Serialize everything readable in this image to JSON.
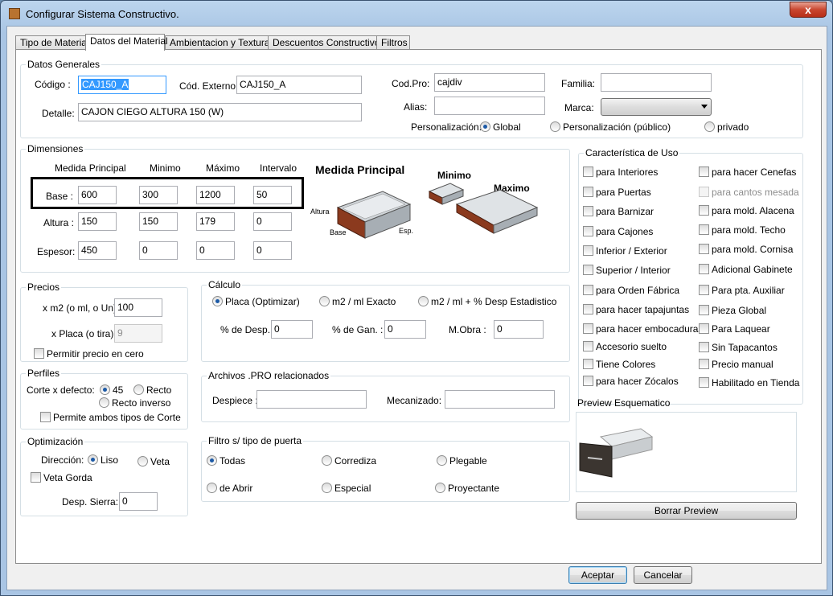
{
  "window": {
    "title": "Configurar Sistema Constructivo.",
    "close_glyph": "x"
  },
  "tabs": [
    "Tipo de Material",
    "Datos del Material",
    "Ambientacion y Texturas",
    "Descuentos Constructivos",
    "Filtros"
  ],
  "datos_generales": {
    "title": "Datos Generales",
    "codigo_label": "Código :",
    "codigo_value": "CAJ150_A",
    "cod_externo_label": "Cód. Externo :",
    "cod_externo_value": "CAJ150_A",
    "detalle_label": "Detalle:",
    "detalle_value": "CAJON CIEGO ALTURA 150 (W)",
    "cod_pro_label": "Cod.Pro:",
    "cod_pro_value": "cajdiv",
    "alias_label": "Alias:",
    "alias_value": "",
    "familia_label": "Familia:",
    "familia_value": "",
    "marca_label": "Marca:",
    "marca_value": "",
    "personalizacion_label": "Personalización:",
    "pers_global": "Global",
    "pers_publico": "Personalización (público)",
    "pers_privado": "privado"
  },
  "dimensiones": {
    "title": "Dimensiones",
    "headers": [
      "Medida Principal",
      "Minimo",
      "Máximo",
      "Intervalo"
    ],
    "rows": [
      {
        "label": "Base :",
        "values": [
          "600",
          "300",
          "1200",
          "50"
        ]
      },
      {
        "label": "Altura :",
        "values": [
          "150",
          "150",
          "179",
          "0"
        ]
      },
      {
        "label": "Espesor:",
        "values": [
          "450",
          "0",
          "0",
          "0"
        ]
      }
    ],
    "image_labels": {
      "medida": "Medida Principal",
      "minimo": "Minimo",
      "maximo": "Maximo",
      "altura": "Altura",
      "base": "Base",
      "esp": "Esp."
    }
  },
  "caracteristica": {
    "title": "Característica de Uso",
    "left": [
      "para Interiores",
      "para Puertas",
      "para Barnizar",
      "para Cajones",
      "Inferior / Exterior",
      "Superior / Interior",
      "para Orden Fábrica",
      "para hacer tapajuntas",
      "para hacer embocaduras",
      "Accesorio suelto",
      "Tiene Colores",
      "para hacer Zócalos"
    ],
    "right": [
      "para hacer Cenefas",
      "para cantos mesada",
      "para mold. Alacena",
      "para mold. Techo",
      "para mold. Cornisa",
      "Adicional Gabinete",
      "Para pta. Auxiliar",
      "Pieza Global",
      "Para Laquear",
      "Sin Tapacantos",
      "Precio manual",
      "Habilitado en Tienda"
    ]
  },
  "precios": {
    "title": "Precios",
    "xm2_label": "x m2 (o ml, o Un) :",
    "xm2_value": "100",
    "xplaca_label": "x Placa (o tira) :",
    "xplaca_value": "9",
    "permitir_cero": "Permitir precio en cero"
  },
  "calculo": {
    "title": "Cálculo",
    "placa": "Placa (Optimizar)",
    "m2_exacto": "m2 / ml Exacto",
    "m2_desp": "m2 / ml + % Desp Estadistico",
    "desp_label": "% de Desp. :",
    "desp_value": "0",
    "gan_label": "% de Gan. :",
    "gan_value": "0",
    "mobra_label": "M.Obra :",
    "mobra_value": "0"
  },
  "perfiles": {
    "title": "Perfiles",
    "corte_label": "Corte x defecto:",
    "opt_45": "45",
    "opt_recto": "Recto",
    "opt_recto_inverso": "Recto inverso",
    "permite_ambos": "Permite ambos tipos de Corte"
  },
  "archivos": {
    "title": "Archivos .PRO relacionados",
    "despiece_label": "Despiece :",
    "despiece_value": "",
    "mecanizado_label": "Mecanizado:",
    "mecanizado_value": ""
  },
  "optimizacion": {
    "title": "Optimización",
    "direccion_label": "Dirección:",
    "liso": "Liso",
    "veta": "Veta",
    "veta_gorda": "Veta Gorda",
    "desp_sierra_label": "Desp. Sierra:",
    "desp_sierra_value": "0"
  },
  "filtro_puerta": {
    "title": "Filtro s/ tipo de puerta",
    "options": [
      "Todas",
      "Corrediza",
      "Plegable",
      "de Abrir",
      "Especial",
      "Proyectante"
    ]
  },
  "preview": {
    "title": "Preview Esquematico",
    "borrar": "Borrar Preview"
  },
  "footer": {
    "aceptar": "Aceptar",
    "cancelar": "Cancelar"
  },
  "colors": {
    "accent": "#3399ff",
    "wood": "#8b3a1e",
    "drawer": "#3b3530"
  }
}
